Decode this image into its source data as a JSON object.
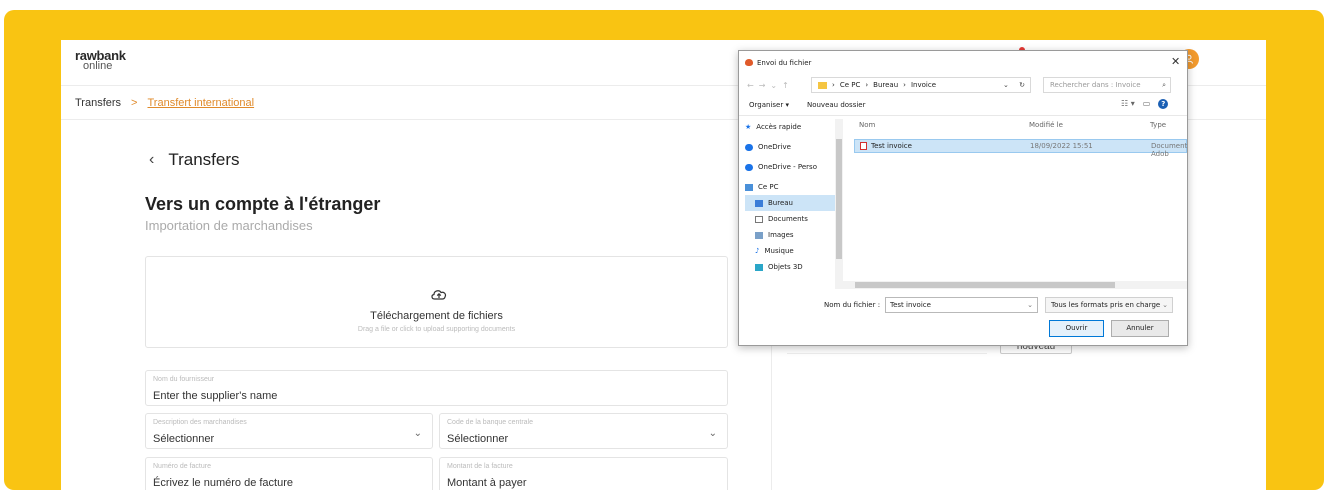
{
  "app": {
    "logo_top": "rawbank",
    "logo_bottom": "online",
    "avatar_icon": "user-icon"
  },
  "breadcrumb": {
    "items": [
      "Transfers",
      "Transfert international"
    ],
    "separator": ">"
  },
  "form": {
    "back_label": "Transfers",
    "heading": "Vers un compte à l'étranger",
    "subheading": "Importation de marchandises",
    "upload": {
      "title": "Téléchargement de fichiers",
      "hint": "Drag a file or click to upload supporting documents"
    },
    "fields": [
      {
        "label": "Nom du fournisseur",
        "value": "Enter the supplier's name"
      },
      {
        "label": "Description des marchandises",
        "value": "Sélectionner"
      },
      {
        "label": "Code de la banque centrale",
        "value": "Sélectionner"
      },
      {
        "label": "Numéro de facture",
        "value": "Écrivez le numéro de facture"
      },
      {
        "label": "Montant de la facture",
        "value": "Montant à payer"
      }
    ],
    "nouveau_label": "nouveau"
  },
  "dialog": {
    "title": "Envoi du fichier",
    "path": [
      "Ce PC",
      "Bureau",
      "Invoice"
    ],
    "search_placeholder": "Rechercher dans : Invoice",
    "organiser": "Organiser",
    "new_folder": "Nouveau dossier",
    "nav_items": [
      "Accès rapide",
      "OneDrive",
      "OneDrive - Perso",
      "Ce PC",
      "Bureau",
      "Documents",
      "Images",
      "Musique",
      "Objets 3D"
    ],
    "selected_nav": "Bureau",
    "columns": [
      "Nom",
      "Modifié le",
      "Type"
    ],
    "files": [
      {
        "name": "Test invoice",
        "modified": "18/09/2022 15:51",
        "type": "Document Adob"
      }
    ],
    "filename_label": "Nom du fichier :",
    "filename_value": "Test invoice",
    "filetype": "Tous les formats pris en charge",
    "open_label": "Ouvrir",
    "cancel_label": "Annuler"
  },
  "colors": {
    "frame": "#f9c412",
    "accent": "#e08a2a",
    "selection": "#cce4f7"
  }
}
